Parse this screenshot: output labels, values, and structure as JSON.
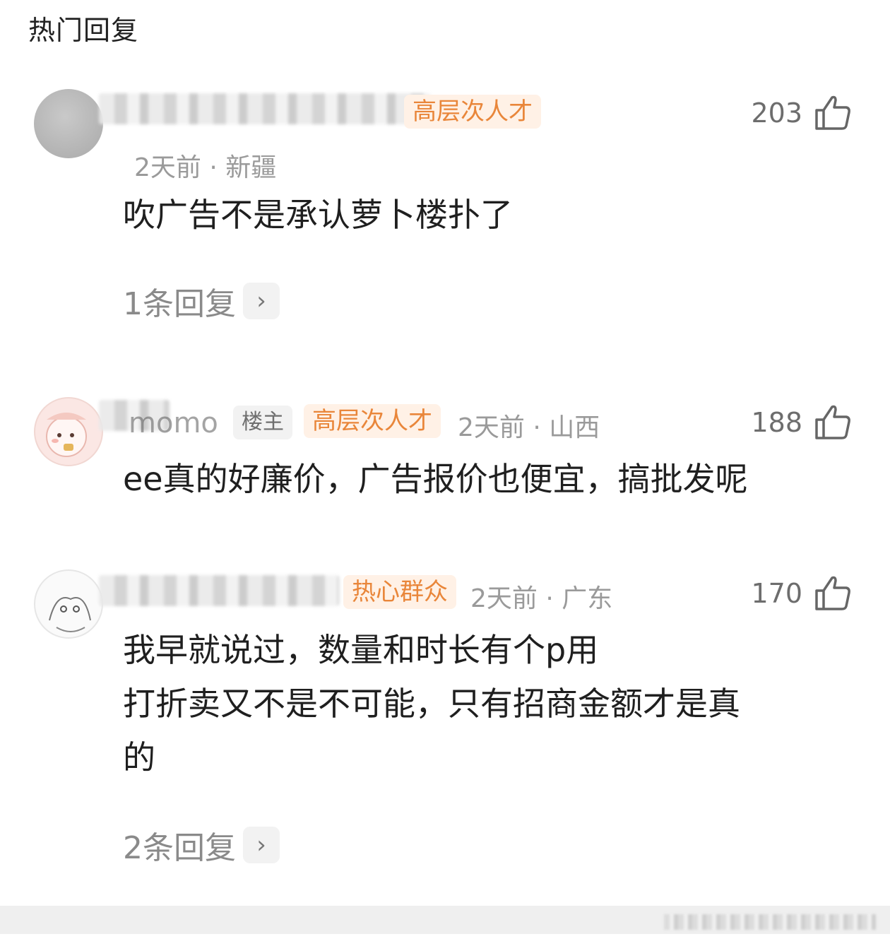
{
  "section": {
    "title": "热门回复"
  },
  "comments": [
    {
      "badge": "高层次人才",
      "time": "2天前",
      "location": "新疆",
      "likes": "203",
      "text_lines": [
        "吹广告不是承认萝卜楼扑了"
      ],
      "reply_label": "1条回复",
      "avatar": "grey-avatar"
    },
    {
      "name_suffix": "momo",
      "author_tag": "楼主",
      "badge": "高层次人才",
      "time": "2天前",
      "location": "山西",
      "likes": "188",
      "text_lines": [
        "ee真的好廉价，广告报价也便宜，搞批发呢"
      ],
      "avatar": "pink-cartoon-avatar"
    },
    {
      "badge": "热心群众",
      "time": "2天前",
      "location": "广东",
      "likes": "170",
      "text_lines": [
        "我早就说过，数量和时长有个p用",
        "打折卖又不是不可能，只有招商金额才是真",
        "的"
      ],
      "reply_label": "2条回复",
      "avatar": "sketch-avatar"
    }
  ],
  "icons": {
    "like": "thumbs-up-icon",
    "chevron": "chevron-right-icon"
  },
  "colors": {
    "badge_text": "#e9863a",
    "badge_bg": "#fff1e6",
    "meta": "#9a9a9a"
  }
}
